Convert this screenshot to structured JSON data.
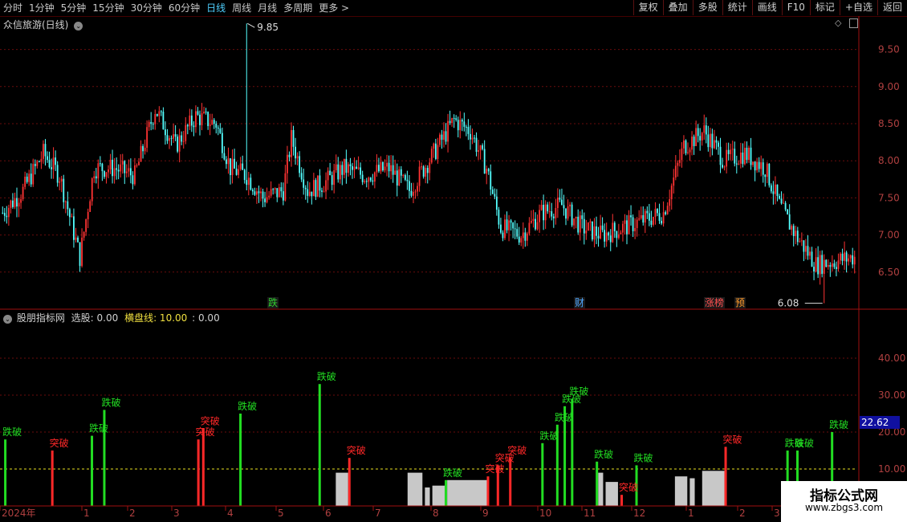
{
  "toolbar": {
    "periods": [
      "分时",
      "1分钟",
      "5分钟",
      "15分钟",
      "30分钟",
      "60分钟",
      "日线",
      "周线",
      "月线",
      "多周期",
      "更多 >"
    ],
    "active": "日线",
    "buttons": [
      "复权",
      "叠加",
      "多股",
      "统计",
      "画线",
      "F10",
      "标记",
      "+自选",
      "返回"
    ]
  },
  "main_pane": {
    "title": "众信旅游(日线)",
    "high_label": "9.85",
    "low_label": "6.08",
    "price_axis": [
      "9.50",
      "9.00",
      "8.50",
      "8.00",
      "7.50",
      "7.00",
      "6.50"
    ],
    "event_tags": [
      {
        "text": "跌",
        "color": "#2fd02f"
      },
      {
        "text": "财",
        "color": "#4fa8ff"
      },
      {
        "text": "涨榜",
        "color": "#ff5050"
      },
      {
        "text": "预",
        "color": "#ff9a2a"
      }
    ]
  },
  "indicator_pane": {
    "name": "股朋指标网",
    "select_label": "选股: 0.00",
    "line_label": "横盘线: 10.00",
    "extra_label": ": 0.00",
    "axis_labels": [
      "40.00",
      "30.00",
      "20.00",
      "10.00"
    ],
    "current_value": "22.62",
    "break_down_label": "跌破",
    "break_up_label": "突破"
  },
  "time_axis": [
    "2024年",
    "1",
    "2",
    "3",
    "4",
    "5",
    "6",
    "7",
    "8",
    "9",
    "10",
    "11",
    "12",
    "1",
    "2",
    "3"
  ],
  "watermark": {
    "title": "指标公式网",
    "url": "www.zbgs3.com"
  },
  "chart_data": [
    {
      "type": "candlestick",
      "title": "众信旅游(日线)",
      "y_range": [
        6.0,
        9.95
      ],
      "anchors": [
        [
          0,
          7.3
        ],
        [
          10,
          7.6
        ],
        [
          20,
          8.1
        ],
        [
          28,
          7.8
        ],
        [
          38,
          6.7
        ],
        [
          45,
          7.9
        ],
        [
          55,
          7.9
        ],
        [
          65,
          7.8
        ],
        [
          75,
          8.7
        ],
        [
          85,
          8.2
        ],
        [
          95,
          8.6
        ],
        [
          105,
          8.5
        ],
        [
          112,
          7.9
        ],
        [
          120,
          7.8
        ],
        [
          128,
          7.5
        ],
        [
          138,
          7.6
        ],
        [
          142,
          8.3
        ],
        [
          150,
          7.6
        ],
        [
          158,
          7.7
        ],
        [
          168,
          7.9
        ],
        [
          178,
          7.8
        ],
        [
          190,
          7.9
        ],
        [
          200,
          7.6
        ],
        [
          212,
          8.1
        ],
        [
          222,
          8.55
        ],
        [
          230,
          8.4
        ],
        [
          238,
          7.9
        ],
        [
          245,
          7.1
        ],
        [
          255,
          7.0
        ],
        [
          265,
          7.3
        ],
        [
          275,
          7.4
        ],
        [
          285,
          7.1
        ],
        [
          295,
          7.0
        ],
        [
          305,
          7.1
        ],
        [
          315,
          7.2
        ],
        [
          325,
          7.3
        ],
        [
          335,
          8.2
        ],
        [
          345,
          8.4
        ],
        [
          355,
          8.0
        ],
        [
          365,
          8.1
        ],
        [
          375,
          7.9
        ],
        [
          382,
          7.4
        ],
        [
          390,
          7.0
        ],
        [
          400,
          6.6
        ],
        [
          410,
          6.65
        ],
        [
          418,
          6.7
        ]
      ],
      "high": 9.85,
      "low": 6.08
    },
    {
      "type": "bar",
      "series": [
        {
          "name": "跌破",
          "color": "#22dd22",
          "bars": [
            [
              1,
              18
            ],
            [
              36,
              19
            ],
            [
              41,
              26
            ],
            [
              96,
              25
            ],
            [
              128,
              33
            ],
            [
              179,
              7
            ],
            [
              218,
              17
            ],
            [
              224,
              22
            ],
            [
              227,
              27
            ],
            [
              230,
              29
            ],
            [
              240,
              12
            ],
            [
              256,
              11
            ],
            [
              317,
              15
            ],
            [
              321,
              15
            ],
            [
              335,
              20
            ]
          ]
        },
        {
          "name": "突破",
          "color": "#ff2828",
          "bars": [
            [
              20,
              15
            ],
            [
              79,
              18
            ],
            [
              81,
              21
            ],
            [
              140,
              13
            ],
            [
              196,
              8
            ],
            [
              200,
              11
            ],
            [
              205,
              13
            ],
            [
              250,
              3
            ],
            [
              292,
              16
            ]
          ]
        }
      ],
      "gray_blocks": [
        [
          135,
          140,
          9
        ],
        [
          164,
          170,
          9
        ],
        [
          171,
          173,
          5
        ],
        [
          174,
          179,
          5.5
        ],
        [
          180,
          196,
          7
        ],
        [
          241,
          243,
          9
        ],
        [
          244,
          249,
          6.5
        ],
        [
          272,
          277,
          8
        ],
        [
          278,
          280,
          7.5
        ],
        [
          283,
          292,
          9.5
        ]
      ],
      "level_line": 10,
      "y_range": [
        0,
        50
      ]
    }
  ]
}
